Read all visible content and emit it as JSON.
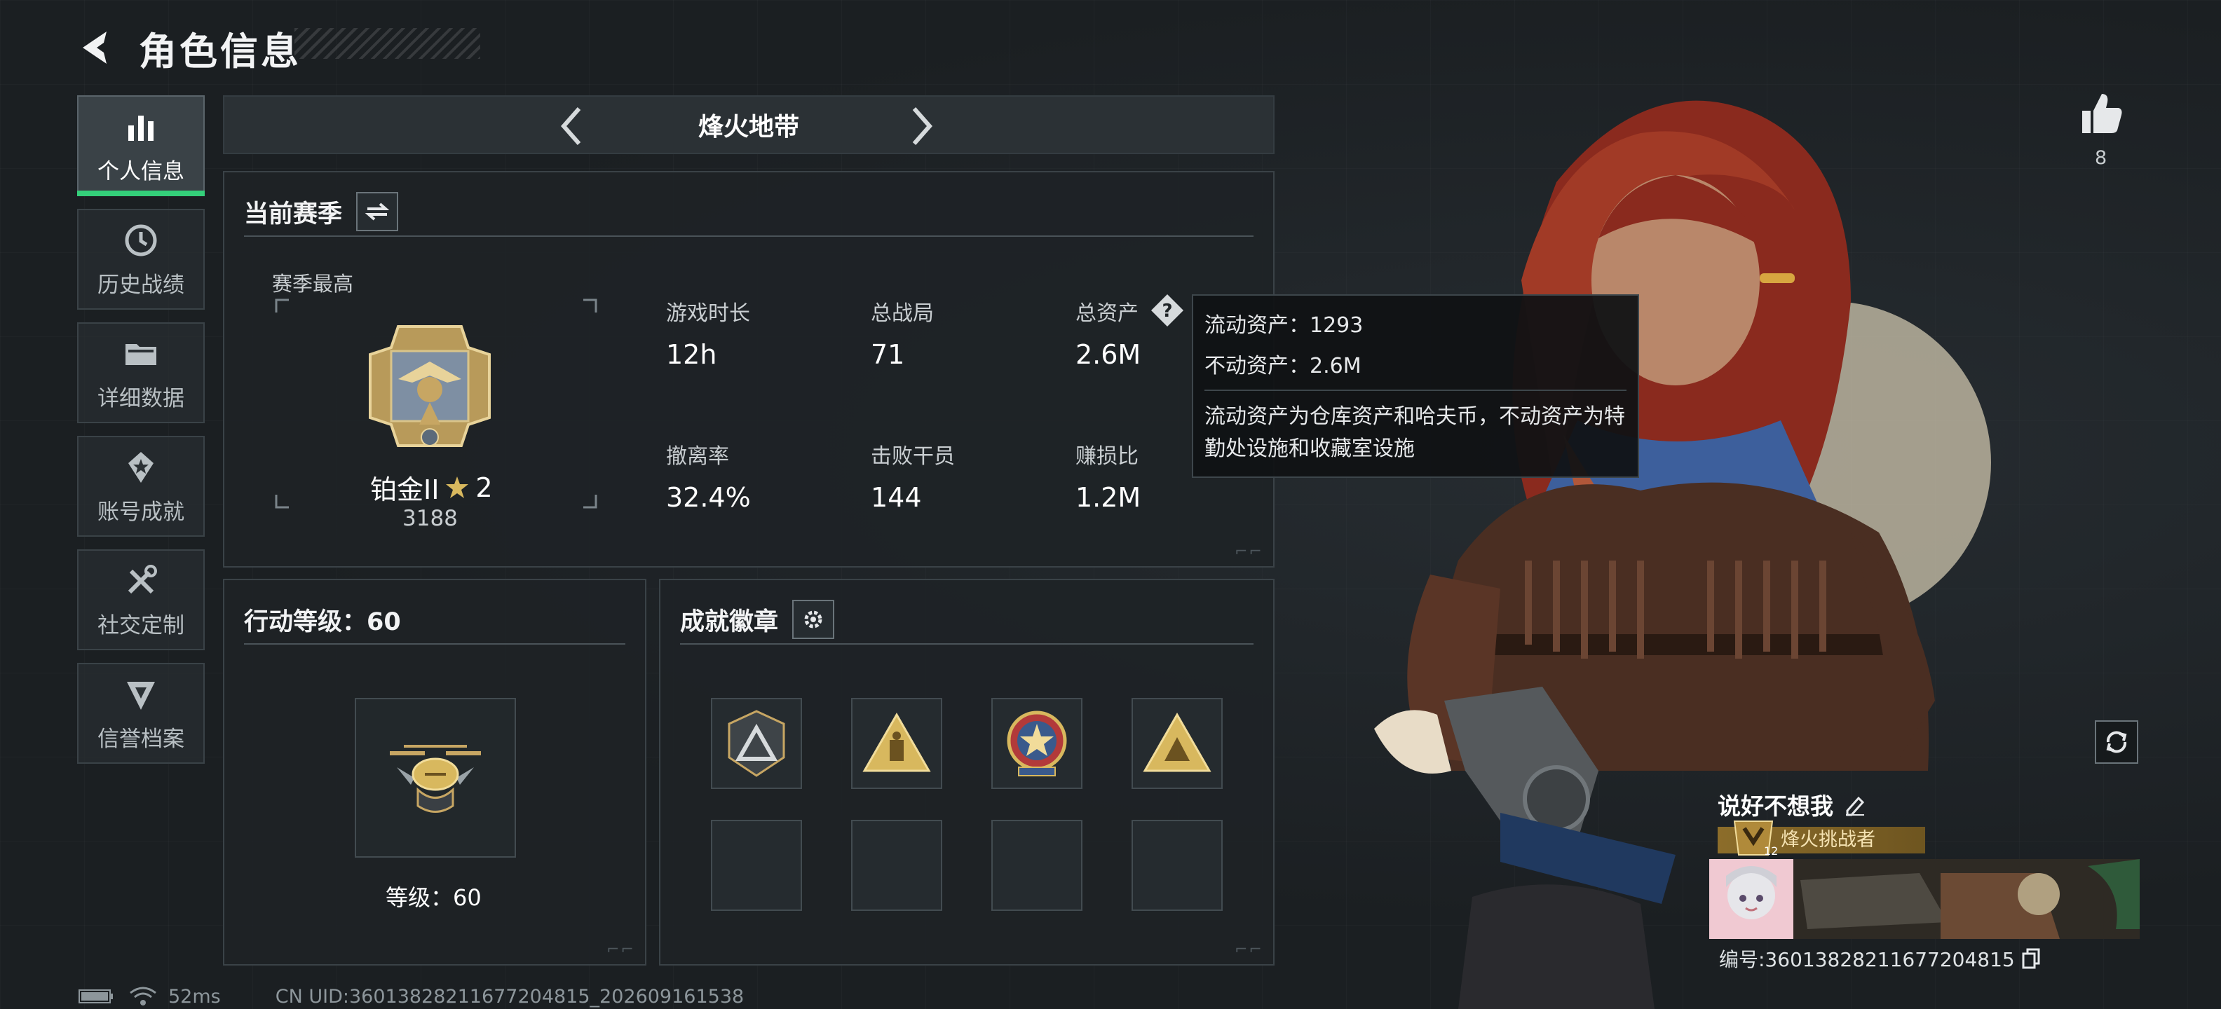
{
  "header": {
    "title": "角色信息"
  },
  "sidebar": {
    "items": [
      {
        "label": "个人信息",
        "icon": "bar-chart-icon",
        "active": true
      },
      {
        "label": "历史战绩",
        "icon": "clock-icon"
      },
      {
        "label": "详细数据",
        "icon": "folder-icon"
      },
      {
        "label": "账号成就",
        "icon": "achievement-icon"
      },
      {
        "label": "社交定制",
        "icon": "tools-icon"
      },
      {
        "label": "信誉档案",
        "icon": "shield-icon"
      }
    ]
  },
  "mode": {
    "title": "烽火地带"
  },
  "season": {
    "title": "当前赛季",
    "subtitle": "赛季最高",
    "rank_name": "铂金II",
    "rank_stars": "2",
    "rank_score": "3188",
    "stats": [
      {
        "label": "游戏时长",
        "value": "12h"
      },
      {
        "label": "总战局",
        "value": "71"
      },
      {
        "label": "总资产",
        "value": "2.6M"
      },
      {
        "label": "撤离率",
        "value": "32.4%"
      },
      {
        "label": "击败干员",
        "value": "144"
      },
      {
        "label": "赚损比",
        "value": "1.2M"
      }
    ]
  },
  "tooltip": {
    "liquid": "流动资产：1293",
    "fixed": "不动资产：2.6M",
    "desc": "流动资产为仓库资产和哈夫币，不动资产为特勤处设施和收藏室设施"
  },
  "level_panel": {
    "title": "行动等级：60",
    "caption": "等级：60"
  },
  "badges_panel": {
    "title": "成就徽章"
  },
  "profile": {
    "likes": "8",
    "name": "说好不想我",
    "title_label": "烽火挑战者",
    "title_level": "125",
    "player_id": "编号:3601382821167720481​5"
  },
  "footer": {
    "ping": "52ms",
    "uid": "CN UID:36013828211677204815_202609161538"
  },
  "colors": {
    "accent_green": "#34d07a",
    "gold": "#c9a45a",
    "panel_bg": "#1e2326"
  }
}
